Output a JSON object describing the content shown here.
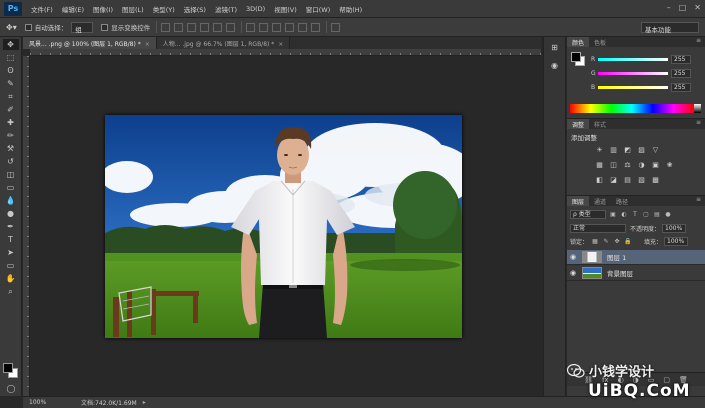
{
  "app": {
    "logo": "Ps",
    "window_controls": [
      "–",
      "□",
      "✕"
    ]
  },
  "menu": [
    "文件(F)",
    "编辑(E)",
    "图像(I)",
    "图层(L)",
    "类型(Y)",
    "选择(S)",
    "滤镜(T)",
    "3D(D)",
    "视图(V)",
    "窗口(W)",
    "帮助(H)"
  ],
  "options": {
    "auto_select_label": "自动选择：",
    "auto_select_value": "组",
    "show_transform_label": "显示变换控件",
    "workspace": "基本功能"
  },
  "tabs": [
    {
      "label": "风景... .png @ 100% (图层 1, RGB/8) *",
      "close": "×"
    },
    {
      "label": "人物... .jpg @ 66.7% (图层 1, RGB/8) *",
      "close": "×"
    }
  ],
  "color_panel": {
    "tabs": [
      "颜色",
      "色板"
    ],
    "sliders": [
      {
        "label": "R",
        "value": "255",
        "gradient": "linear-gradient(to right, #00ffff, #ffffff)"
      },
      {
        "label": "G",
        "value": "255",
        "gradient": "linear-gradient(to right, #ff00ff, #ffffff)"
      },
      {
        "label": "B",
        "value": "255",
        "gradient": "linear-gradient(to right, #ffff00, #ffffff)"
      }
    ]
  },
  "adjustments_panel": {
    "tabs": [
      "调整",
      "样式"
    ],
    "title": "添加调整",
    "rows": [
      [
        "☀",
        "▥",
        "◩",
        "▨",
        "▽"
      ],
      [
        "▦",
        "◫",
        "⚖",
        "◑",
        "▣",
        "❀"
      ],
      [
        "◧",
        "◪",
        "▤",
        "▧",
        "▩"
      ]
    ]
  },
  "layers_panel": {
    "tabs": [
      "图层",
      "通道",
      "路径"
    ],
    "filter_label": "ρ 类型",
    "blend_mode": "正常",
    "opacity_label": "不透明度：",
    "opacity_value": "100%",
    "lock_label": "锁定：",
    "fill_label": "填充：",
    "fill_value": "100%",
    "layers": [
      {
        "name": "图层 1",
        "selected": true
      },
      {
        "name": "背景图层",
        "selected": false
      }
    ],
    "footer_icons": [
      "⛓",
      "fx",
      "◐",
      "◑",
      "▭",
      "▢",
      "🗑"
    ]
  },
  "status": {
    "zoom": "100%",
    "doc_info": "文档:742.0K/1.69M",
    "arrow": "▸"
  },
  "watermarks": {
    "wechat": "小钱学设计",
    "site": "UiBQ.CoM"
  },
  "icons": {
    "tools": [
      "move-icon",
      "marquee-icon",
      "lasso-icon",
      "quick-select-icon",
      "crop-icon",
      "eyedropper-icon",
      "healing-icon",
      "brush-icon",
      "stamp-icon",
      "history-brush-icon",
      "eraser-icon",
      "gradient-icon",
      "blur-icon",
      "dodge-icon",
      "pen-icon",
      "type-icon",
      "path-select-icon",
      "shape-icon",
      "hand-icon",
      "zoom-icon",
      "quick-mask-icon",
      "screen-mode-icon"
    ],
    "tool_glyphs": [
      "✥",
      "⬚",
      "ʘ",
      "✎",
      "⌗",
      "✐",
      "✚",
      "✏",
      "⚒",
      "↺",
      "◫",
      "▭",
      "💧",
      "●",
      "✒",
      "T",
      "➤",
      "▭",
      "✋",
      "⌕",
      "◯",
      "▣"
    ]
  },
  "colors": {
    "foreground": "#000000",
    "background": "#ffffff",
    "selected_layer": "#556479"
  }
}
